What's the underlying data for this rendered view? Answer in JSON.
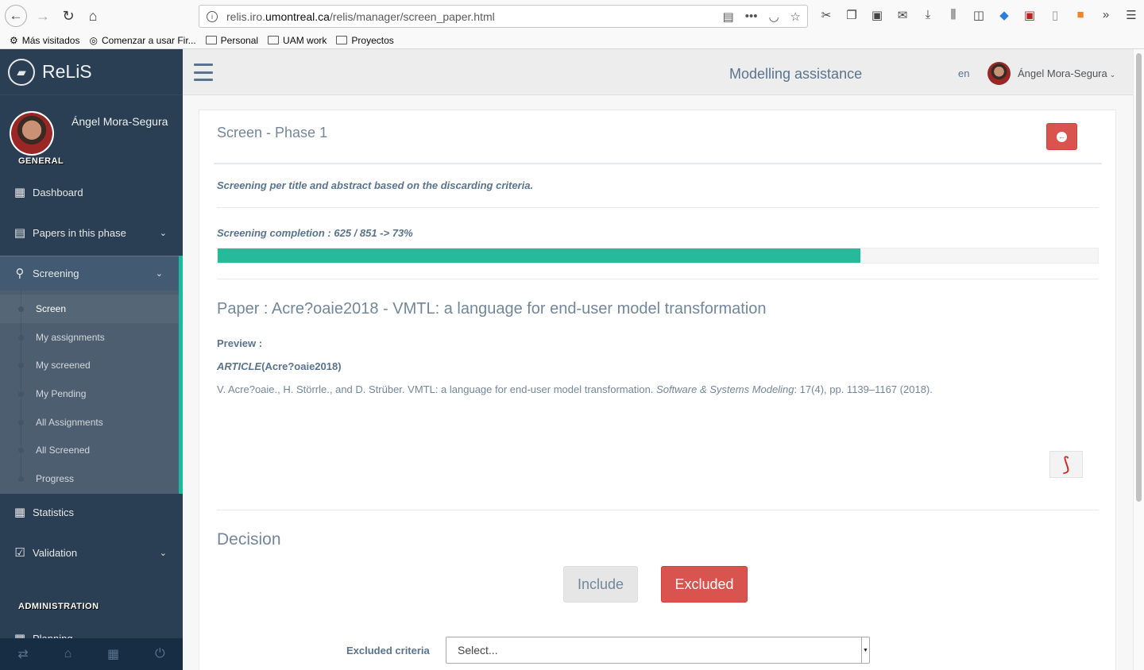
{
  "browser": {
    "url_prefix": "relis.iro.",
    "url_host": "umontreal.ca",
    "url_path": "/relis/manager/screen_paper.html",
    "bookmarks": [
      "Más visitados",
      "Comenzar a usar Fir...",
      "Personal",
      "UAM work",
      "Proyectos"
    ]
  },
  "app": {
    "brand": "ReLiS",
    "title": "Modelling assistance",
    "language": "en",
    "user_name": "Ángel Mora-Segura"
  },
  "sidebar": {
    "profile_name": "Ángel Mora-Segura",
    "section_general": "GENERAL",
    "section_admin": "ADMINISTRATION",
    "items": [
      {
        "label": "Dashboard",
        "icon": "grid-icon"
      },
      {
        "label": "Papers in this phase",
        "icon": "newspaper-icon"
      },
      {
        "label": "Screening",
        "icon": "search-icon"
      },
      {
        "label": "Statistics",
        "icon": "grid-icon"
      },
      {
        "label": "Validation",
        "icon": "check-square-icon"
      },
      {
        "label": "Planning",
        "icon": "grid-icon"
      }
    ],
    "screening_children": [
      "Screen",
      "My assignments",
      "My screened",
      "My Pending",
      "All Assignments",
      "All Screened",
      "Progress"
    ],
    "accent": "#1abb9c"
  },
  "main": {
    "panel_title": "Screen - Phase 1",
    "description": "Screening per title and abstract based on the discarding criteria.",
    "completion_text": "Screening completion : 625 / 851 -> 73%",
    "completion_percent": 73,
    "paper_title": "Paper : Acre?oaie2018 - VMTL: a language for end-user model transformation",
    "preview_label": "Preview :",
    "article_type": "ARTICLE",
    "article_key": "(Acre?oaie2018)",
    "citation_authors": "V. Acre?oaie., H. Störrle., and D. Strüber. VMTL: a language for end-user model transformation.",
    "citation_journal": "Software & Systems Modeling",
    "citation_details": ": 17(4), pp. 1139–1167 (2018).",
    "decision_title": "Decision",
    "include_label": "Include",
    "excluded_label": "Excluded",
    "criteria_label": "Excluded criteria",
    "criteria_value": "Select..."
  },
  "colors": {
    "danger": "#d9534f",
    "success": "#26b99a",
    "sidebar_bg": "#2a3f54"
  }
}
